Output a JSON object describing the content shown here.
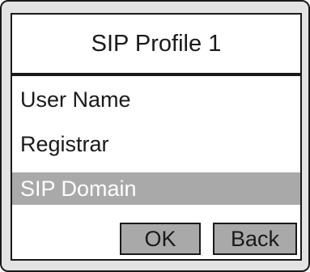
{
  "header": {
    "title": "SIP Profile 1"
  },
  "menu": {
    "items": [
      {
        "label": "User Name",
        "selected": false
      },
      {
        "label": "Registrar",
        "selected": false
      },
      {
        "label": "SIP Domain",
        "selected": true
      }
    ]
  },
  "softkeys": {
    "ok_label": "OK",
    "back_label": "Back"
  },
  "colors": {
    "highlight": "#a9a9a9",
    "bezel": "#e3e3e3",
    "screen": "#ffffff",
    "ink": "#1a1a1a"
  }
}
